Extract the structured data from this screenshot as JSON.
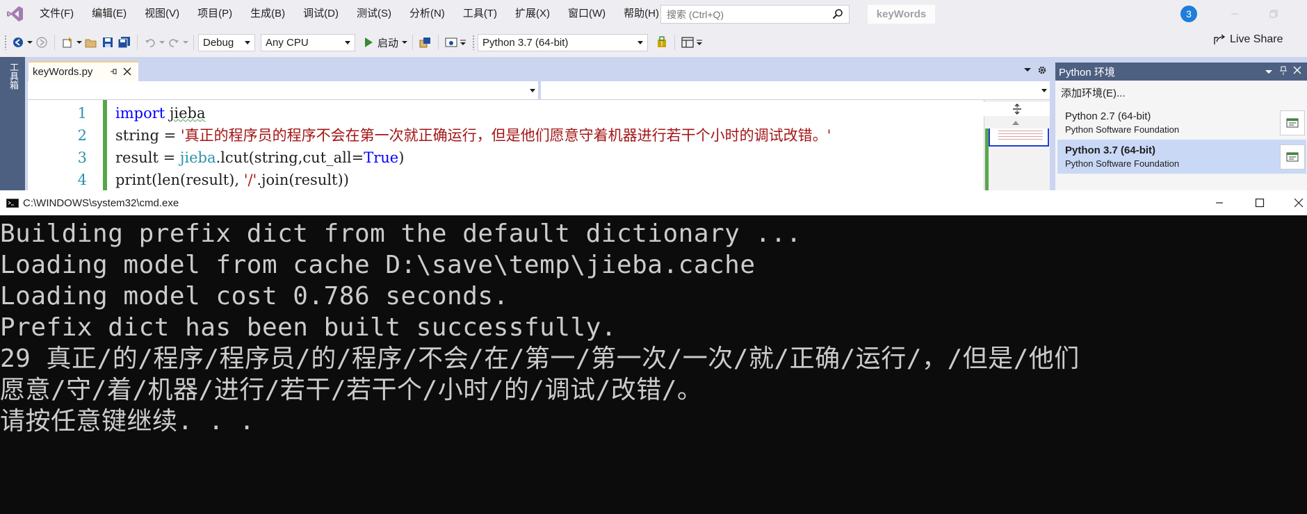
{
  "menubar": {
    "items": [
      "文件(F)",
      "编辑(E)",
      "视图(V)",
      "项目(P)",
      "生成(B)",
      "调试(D)",
      "测试(S)",
      "分析(N)",
      "工具(T)",
      "扩展(X)",
      "窗口(W)",
      "帮助(H)"
    ],
    "search_placeholder": "搜索 (Ctrl+Q)",
    "solution_name": "keyWords",
    "notification_count": "3"
  },
  "toolbar": {
    "config": "Debug",
    "platform": "Any CPU",
    "start_label": "启动",
    "python_env": "Python 3.7 (64-bit)",
    "live_share": "Live Share"
  },
  "toolbox": {
    "label": "工具箱"
  },
  "editor": {
    "tab_title": "keyWords.py",
    "lines": [
      {
        "num": "1"
      },
      {
        "num": "2",
        "string_literal": "'真正的程序员的程序不会在第一次就正确运行，但是他们愿意守着机器进行若干个小时的调试改错。'"
      },
      {
        "num": "3"
      },
      {
        "num": "4"
      }
    ]
  },
  "python_env_panel": {
    "title": "Python 环境",
    "add_env": "添加环境(E)...",
    "environments": [
      {
        "name": "Python 2.7 (64-bit)",
        "vendor": "Python Software Foundation",
        "selected": false
      },
      {
        "name": "Python 3.7 (64-bit)",
        "vendor": "Python Software Foundation",
        "selected": true
      }
    ]
  },
  "cmd": {
    "title": "C:\\WINDOWS\\system32\\cmd.exe",
    "output": [
      "Building prefix dict from the default dictionary ...",
      "Loading model from cache D:\\save\\temp\\jieba.cache",
      "Loading model cost 0.786 seconds.",
      "Prefix dict has been built successfully.",
      "29 真正/的/程序/程序员/的/程序/不会/在/第一/第一次/一次/就/正确/运行/，/但是/他们",
      "愿意/守/着/机器/进行/若干/若干个/小时/的/调试/改错/。",
      "请按任意键继续. . ."
    ]
  },
  "colors": {
    "menu_bg": "#eeeef2",
    "ide_accent": "#4d6082",
    "editor_keyword": "#0000ff",
    "editor_string": "#a31515",
    "editor_linenum": "#2b91af",
    "cmd_bg": "#0c0c0c",
    "cmd_text": "#cccccc"
  }
}
